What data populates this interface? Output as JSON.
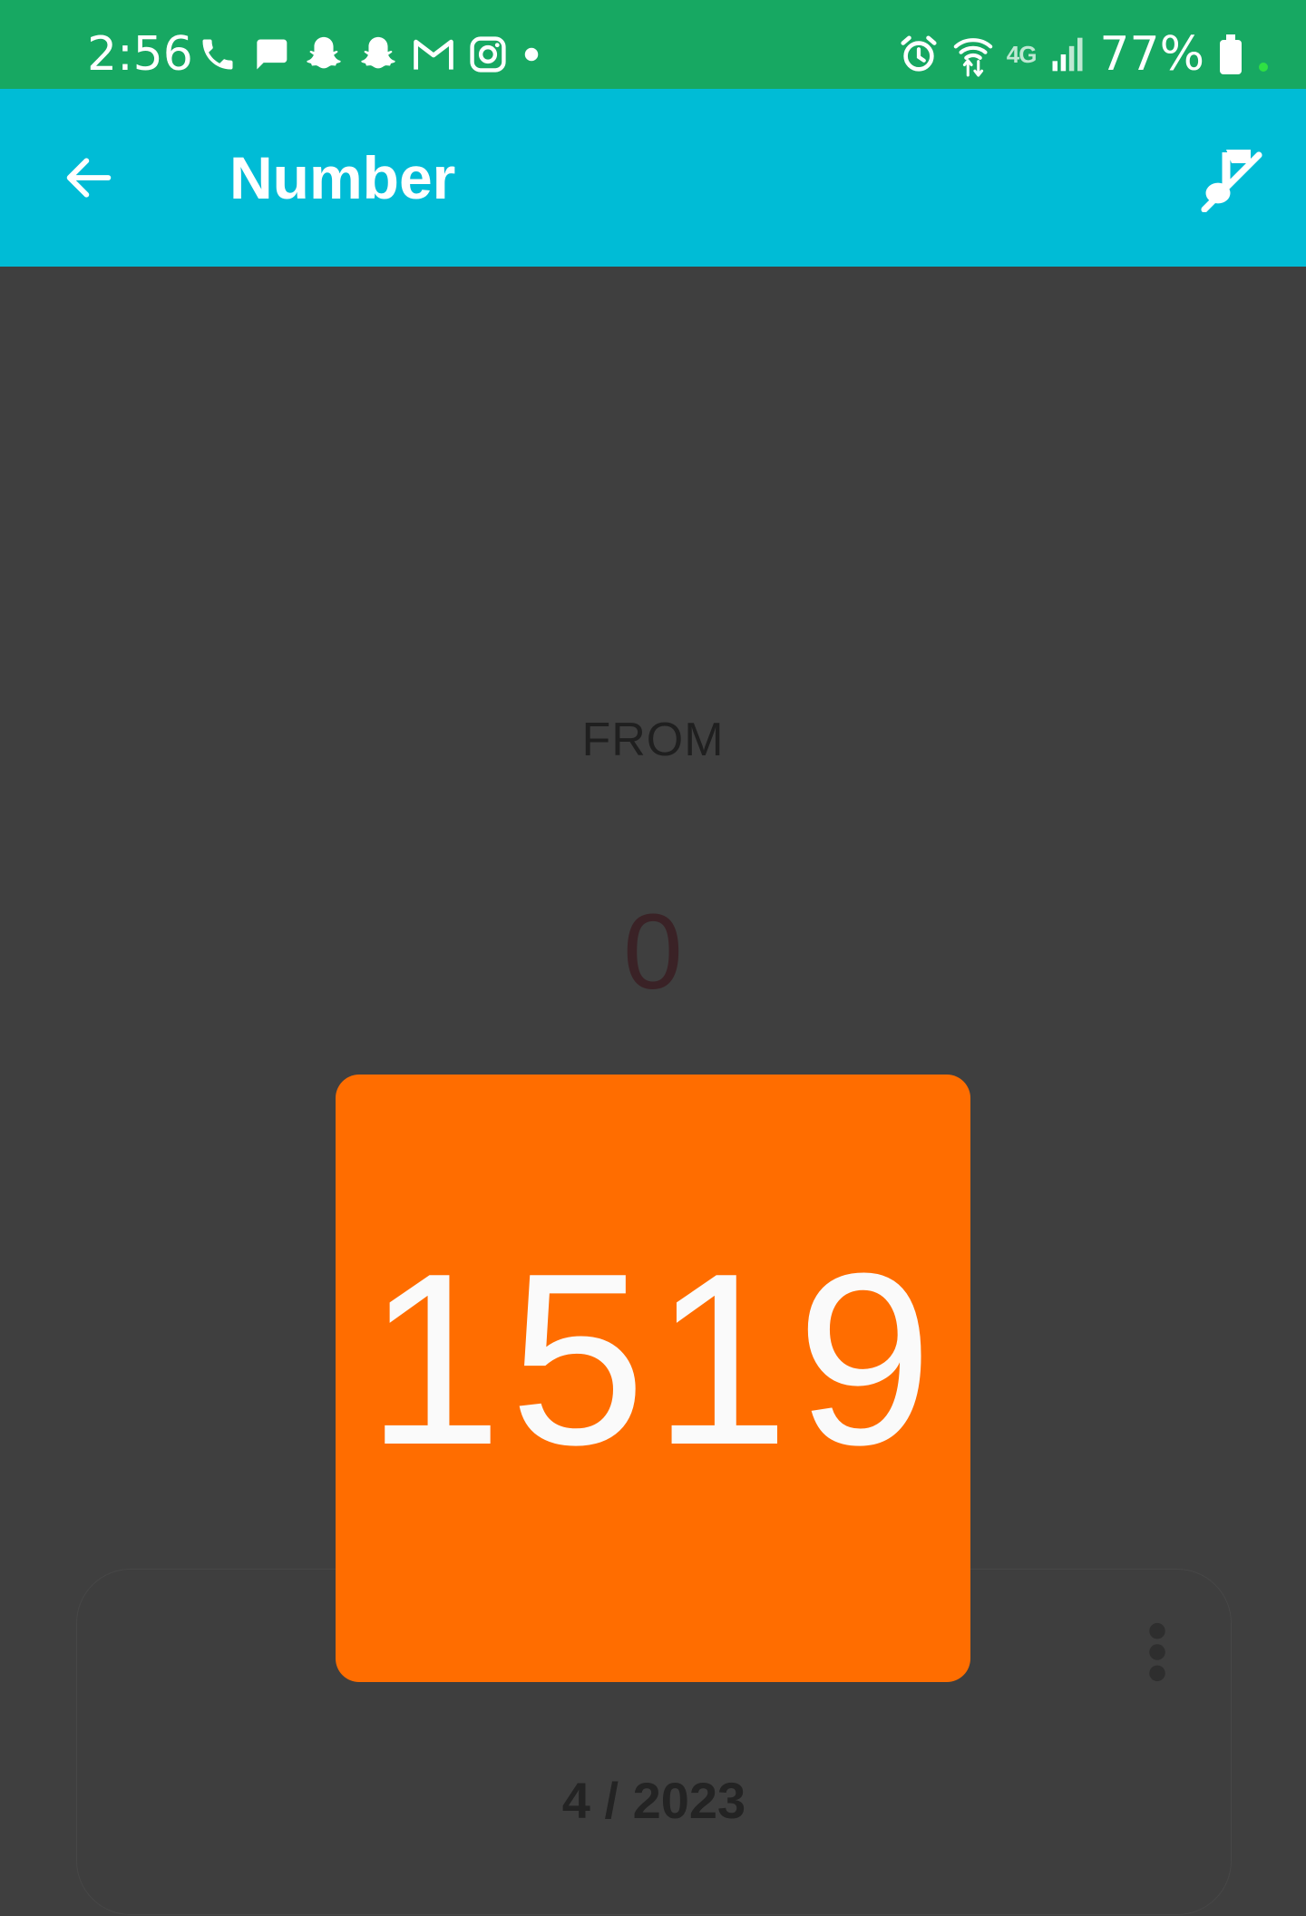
{
  "status_bar": {
    "time": "2:56",
    "battery": "77%",
    "network": "4G",
    "left_icons": [
      "phone-icon",
      "message-icon",
      "snapchat-icon",
      "snapchat-icon",
      "gmail-icon",
      "instagram-icon",
      "dot-icon"
    ],
    "right_icons": [
      "alarm-icon",
      "wifi-icon",
      "lte-icon",
      "signal-icon",
      "battery-icon"
    ]
  },
  "app_bar": {
    "title": "Number",
    "back_icon": "arrow-left-icon",
    "action_icon": "music-note-off-icon"
  },
  "main": {
    "from_label": "FROM",
    "from_value": "0",
    "current_number": "1519"
  },
  "bottom_panel": {
    "date": "4 / 2023",
    "menu_icon": "more-vertical-icon"
  },
  "colors": {
    "status_bar": "#17a862",
    "app_bar": "#00bcd6",
    "background": "#3f3f3f",
    "card": "#ff6d00"
  }
}
